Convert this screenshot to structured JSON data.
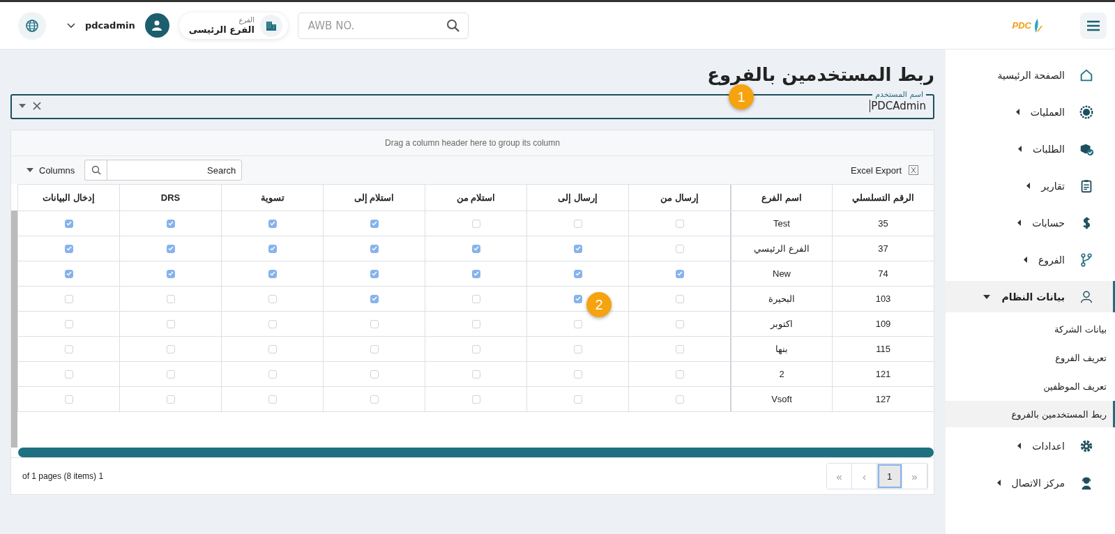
{
  "header": {
    "logo": "PDC",
    "search": {
      "placeholder": "AWB NO."
    },
    "branch": {
      "label": "الفرع",
      "value": "الفرع الرئيسى"
    },
    "user": {
      "name": "pdcadmin"
    }
  },
  "sidebar": {
    "items": [
      {
        "label": "الصفحة الرئيسية",
        "selected": false
      },
      {
        "label": "العمليات",
        "expanded": false,
        "selected": false
      },
      {
        "label": "الطلبات",
        "expanded": false,
        "selected": false
      },
      {
        "label": "تقارير",
        "expanded": false,
        "selected": false
      },
      {
        "label": "حسابات",
        "expanded": false,
        "selected": false
      },
      {
        "label": "الفروع",
        "expanded": false,
        "selected": false
      },
      {
        "label": "بيانات النظام",
        "expanded": true,
        "selected": true,
        "children": [
          {
            "label": "بيانات الشركة",
            "selected": false
          },
          {
            "label": "تعريف الفروع",
            "selected": false
          },
          {
            "label": "تعريف الموظفين",
            "selected": false
          },
          {
            "label": "ربط المستخدمين بالفروع",
            "selected": true
          }
        ]
      },
      {
        "label": "اعدادات",
        "expanded": false,
        "selected": false
      },
      {
        "label": "مركز الاتصال",
        "expanded": false,
        "selected": false
      }
    ]
  },
  "page": {
    "title": "ربط المستخدمين بالفروع",
    "user_field": {
      "label": "اسم المستخدم",
      "value": "PDCAdmin"
    }
  },
  "callouts": [
    "1",
    "2"
  ],
  "grid": {
    "group_panel": "Drag a column header here to group its column",
    "excel_export": "Excel Export",
    "columns_button": "Columns",
    "search": {
      "placeholder": "Search"
    },
    "columns": [
      "الرقم التسلسلي",
      "اسم الفرع",
      "إرسال من",
      "إرسال إلى",
      "استلام من",
      "استلام إلى",
      "تسوية",
      "DRS",
      "إدخال البيانات"
    ],
    "rows": [
      {
        "serial": "35",
        "branch": "Test",
        "checks": [
          {
            "checked": false
          },
          {
            "checked": false
          },
          {
            "checked": false
          },
          {
            "checked": true
          },
          {
            "checked": true
          },
          {
            "checked": true
          },
          {
            "checked": true
          }
        ]
      },
      {
        "serial": "37",
        "branch": "الفرع الرئيسي",
        "checks": [
          {
            "checked": false
          },
          {
            "checked": true
          },
          {
            "checked": true
          },
          {
            "checked": true
          },
          {
            "checked": true
          },
          {
            "checked": true
          },
          {
            "checked": true
          }
        ]
      },
      {
        "serial": "74",
        "branch": "New",
        "checks": [
          {
            "checked": true
          },
          {
            "checked": true
          },
          {
            "checked": true
          },
          {
            "checked": true
          },
          {
            "checked": true
          },
          {
            "checked": true
          },
          {
            "checked": true
          }
        ]
      },
      {
        "serial": "103",
        "branch": "البحيرة",
        "checks": [
          {
            "checked": false
          },
          {
            "checked": true
          },
          {
            "checked": false
          },
          {
            "checked": true
          },
          {
            "checked": false
          },
          {
            "checked": false
          },
          {
            "checked": false
          }
        ]
      },
      {
        "serial": "109",
        "branch": "اكتوبر",
        "checks": [
          {
            "checked": false
          },
          {
            "checked": false
          },
          {
            "checked": false
          },
          {
            "checked": false
          },
          {
            "checked": false
          },
          {
            "checked": false
          },
          {
            "checked": false
          }
        ]
      },
      {
        "serial": "115",
        "branch": "بنها",
        "checks": [
          {
            "checked": false
          },
          {
            "checked": false
          },
          {
            "checked": false
          },
          {
            "checked": false
          },
          {
            "checked": false
          },
          {
            "checked": false
          },
          {
            "checked": false
          }
        ]
      },
      {
        "serial": "121",
        "branch": "2",
        "checks": [
          {
            "checked": false
          },
          {
            "checked": false
          },
          {
            "checked": false
          },
          {
            "checked": false
          },
          {
            "checked": false
          },
          {
            "checked": false
          },
          {
            "checked": false
          }
        ]
      },
      {
        "serial": "127",
        "branch": "Vsoft",
        "checks": [
          {
            "checked": false
          },
          {
            "checked": false
          },
          {
            "checked": false
          },
          {
            "checked": false
          },
          {
            "checked": false
          },
          {
            "checked": false
          },
          {
            "checked": false
          }
        ]
      }
    ]
  },
  "pager": {
    "summary": "of 1 pages (8 items) 1",
    "buttons": [
      {
        "label": "»",
        "selected": false
      },
      {
        "label": "1",
        "selected": true
      },
      {
        "label": "‹",
        "selected": false
      },
      {
        "label": "«",
        "selected": false
      }
    ]
  }
}
